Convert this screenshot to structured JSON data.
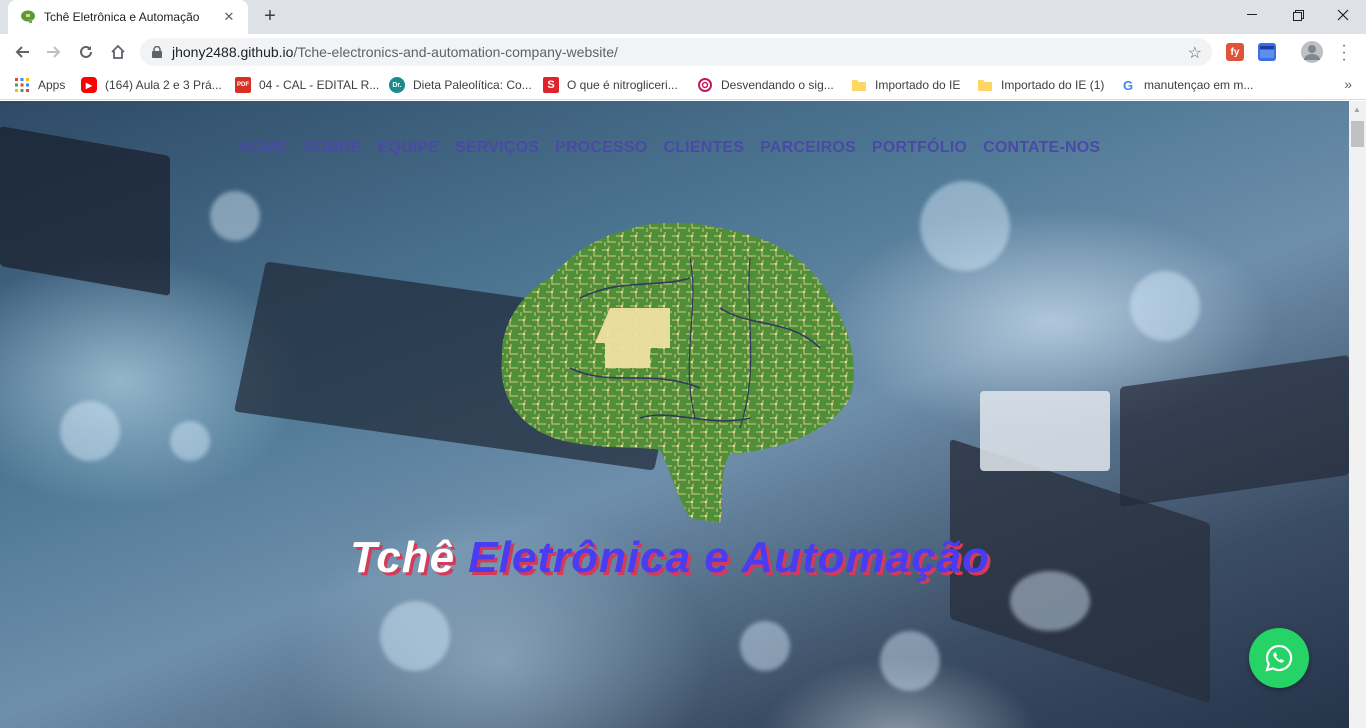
{
  "browser": {
    "tab_title": "Tchê Eletrônica e Automação",
    "new_tab": "+",
    "url_host": "jhony2488.github.io",
    "url_path": "/Tche-electronics-and-automation-company-website/",
    "bookmarks": [
      {
        "label": "Apps",
        "icon": "apps-grid-icon"
      },
      {
        "label": "(164) Aula 2 e 3 Prá...",
        "icon": "youtube-icon"
      },
      {
        "label": "04 - CAL - EDITAL R...",
        "icon": "pdf-icon"
      },
      {
        "label": "Dieta Paleolítica: Co...",
        "icon": "dr-icon"
      },
      {
        "label": "O que é nitrogliceri...",
        "icon": "s-icon"
      },
      {
        "label": "Desvendando o sig...",
        "icon": "spiral-icon"
      },
      {
        "label": "Importado do IE",
        "icon": "folder-icon"
      },
      {
        "label": "Importado do IE (1)",
        "icon": "folder-icon"
      },
      {
        "label": "manutençao em m...",
        "icon": "google-icon"
      }
    ],
    "more_bookmarks": "»"
  },
  "page": {
    "nav": [
      "HOME",
      "SOBRE",
      "EQUIPE",
      "SERVIÇOS",
      "PROCESSO",
      "CLIENTES",
      "PARCEIROS",
      "PORTFÓLIO",
      "CONTATE-NOS"
    ],
    "hero_title_part1": "Tchê ",
    "hero_title_part2": "Eletrônica e Automação",
    "whatsapp_icon": "whatsapp-icon"
  },
  "colors": {
    "nav": "#4a4aa6",
    "hero_accent": "#4a3cf0",
    "hero_shadow": "#d43b5a",
    "whatsapp": "#25d366"
  }
}
